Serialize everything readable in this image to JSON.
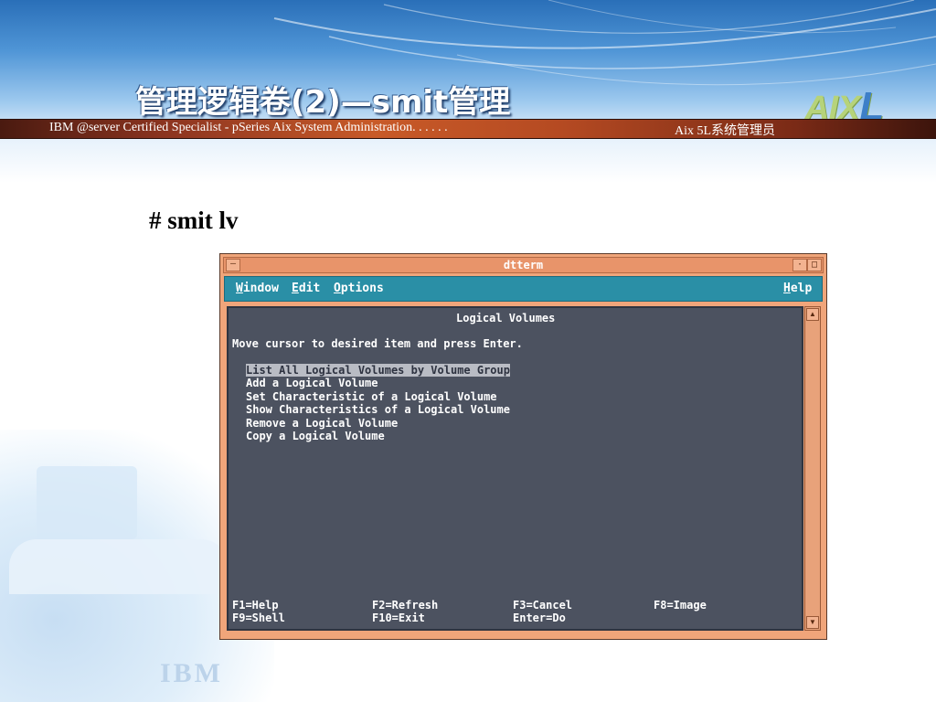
{
  "slide": {
    "title": "管理逻辑卷(2)—smit管理",
    "banner_left": "IBM @server Certified Specialist - pSeries Aix System Administration. . . . . .",
    "banner_right": "Aix 5L系统管理员",
    "logo_text": "AIX",
    "logo_suffix": "L",
    "command": "# smit lv",
    "corner_logo": "IBM"
  },
  "window": {
    "title": "dtterm",
    "menu_btn_icon": "menu-dash-icon",
    "menu": [
      "Window",
      "Edit",
      "Options"
    ],
    "help": "Help"
  },
  "terminal": {
    "heading": "Logical Volumes",
    "instruction": "Move cursor to desired item and press Enter.",
    "items": [
      "List All Logical Volumes by Volume Group",
      "Add a Logical Volume",
      "Set Characteristic of a Logical Volume",
      "Show Characteristics of a Logical Volume",
      "Remove a Logical Volume",
      "Copy a Logical Volume"
    ],
    "selected_index": 0,
    "fkeys": [
      [
        "F1=Help",
        "F2=Refresh",
        "F3=Cancel",
        "F8=Image"
      ],
      [
        "F9=Shell",
        "F10=Exit",
        "Enter=Do",
        ""
      ]
    ]
  }
}
